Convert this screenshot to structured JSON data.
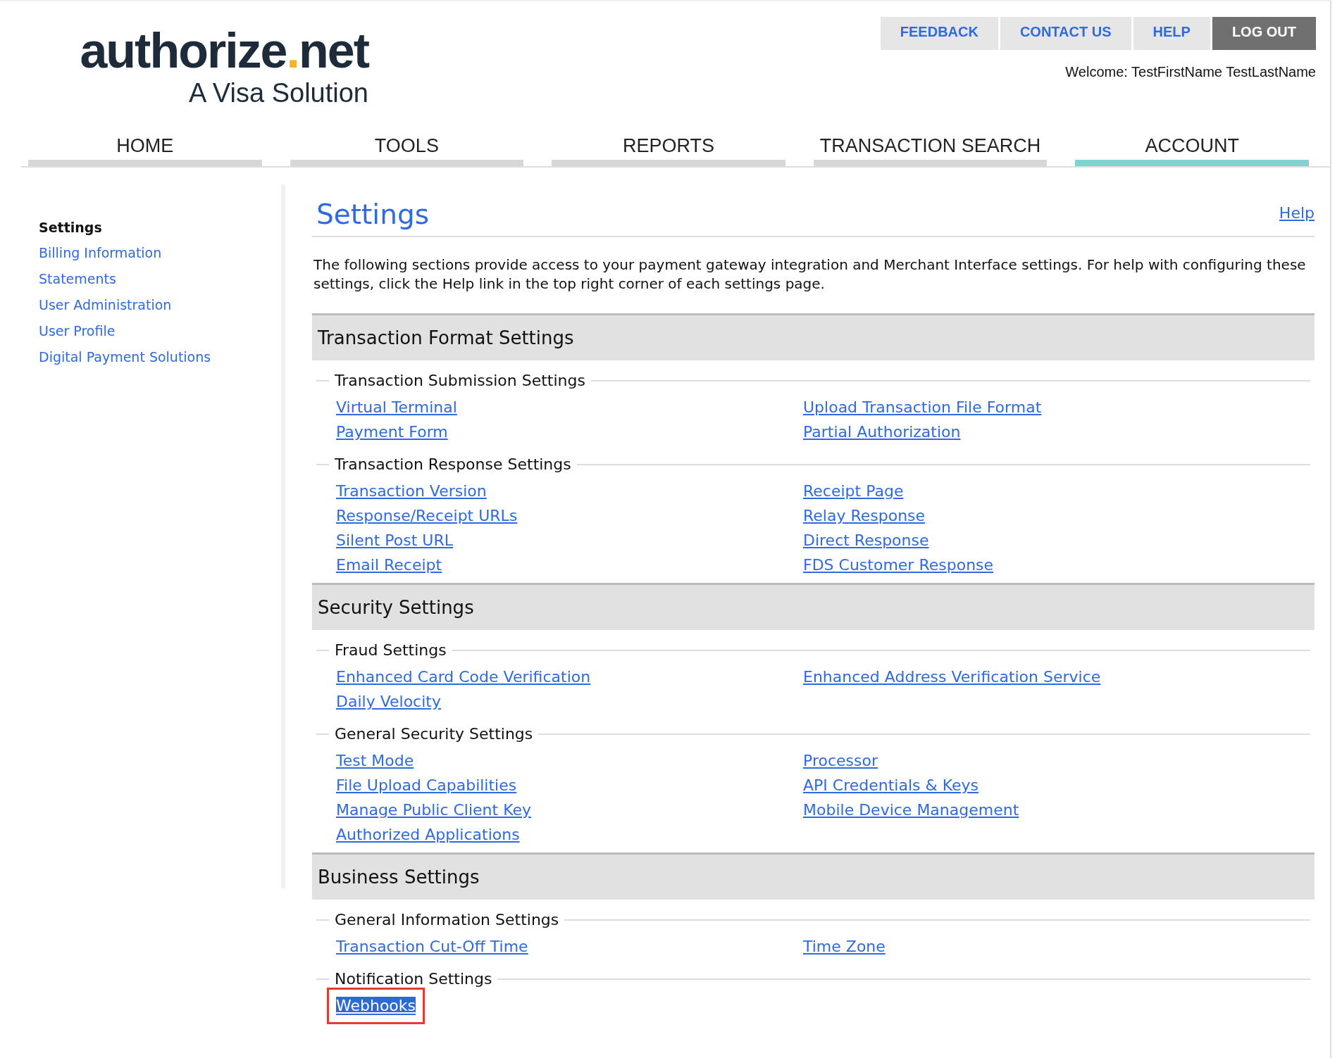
{
  "logo": {
    "wordmark_start": "authorize",
    "wordmark_dot": ".",
    "wordmark_end": "net",
    "tagline": "A Visa Solution"
  },
  "utility_tabs": [
    {
      "label": "FEEDBACK",
      "kind": "light"
    },
    {
      "label": "CONTACT US",
      "kind": "light"
    },
    {
      "label": "HELP",
      "kind": "light"
    },
    {
      "label": "LOG OUT",
      "kind": "dark"
    }
  ],
  "welcome": "Welcome: TestFirstName TestLastName",
  "nav": [
    {
      "label": "HOME",
      "selected": false
    },
    {
      "label": "TOOLS",
      "selected": false
    },
    {
      "label": "REPORTS",
      "selected": false
    },
    {
      "label": "TRANSACTION SEARCH",
      "selected": false
    },
    {
      "label": "ACCOUNT",
      "selected": true
    }
  ],
  "sidebar": {
    "heading": "Settings",
    "items": [
      "Billing Information",
      "Statements",
      "User Administration",
      "User Profile",
      "Digital Payment Solutions"
    ]
  },
  "page": {
    "title": "Settings",
    "help_link": "Help",
    "intro": "The following sections provide access to your payment gateway integration and Merchant Interface settings. For help with configuring these settings, click the Help link in the top right corner of each settings page."
  },
  "sections": [
    {
      "title": "Transaction Format Settings",
      "groups": [
        {
          "title": "Transaction Submission Settings",
          "column_1": [
            {
              "label": "Virtual Terminal",
              "highlighted": false
            },
            {
              "label": "Payment Form",
              "highlighted": false
            }
          ],
          "column_2": [
            {
              "label": "Upload Transaction File Format",
              "highlighted": false
            },
            {
              "label": "Partial Authorization",
              "highlighted": false
            }
          ]
        },
        {
          "title": "Transaction Response Settings",
          "column_1": [
            {
              "label": "Transaction Version",
              "highlighted": false
            },
            {
              "label": "Response/Receipt URLs",
              "highlighted": false
            },
            {
              "label": "Silent Post URL",
              "highlighted": false
            },
            {
              "label": "Email Receipt",
              "highlighted": false
            }
          ],
          "column_2": [
            {
              "label": "Receipt Page",
              "highlighted": false
            },
            {
              "label": "Relay Response",
              "highlighted": false
            },
            {
              "label": "Direct Response",
              "highlighted": false
            },
            {
              "label": "FDS Customer Response",
              "highlighted": false
            }
          ]
        }
      ]
    },
    {
      "title": "Security Settings",
      "groups": [
        {
          "title": "Fraud Settings",
          "column_1": [
            {
              "label": "Enhanced Card Code Verification",
              "highlighted": false
            },
            {
              "label": "Daily Velocity",
              "highlighted": false
            }
          ],
          "column_2": [
            {
              "label": "Enhanced Address Verification Service",
              "highlighted": false
            }
          ]
        },
        {
          "title": "General Security Settings",
          "column_1": [
            {
              "label": "Test Mode",
              "highlighted": false
            },
            {
              "label": "File Upload Capabilities",
              "highlighted": false
            },
            {
              "label": "Manage Public Client Key",
              "highlighted": false
            },
            {
              "label": "Authorized Applications",
              "highlighted": false
            }
          ],
          "column_2": [
            {
              "label": "Processor",
              "highlighted": false
            },
            {
              "label": "API Credentials & Keys",
              "highlighted": false
            },
            {
              "label": "Mobile Device Management",
              "highlighted": false
            }
          ]
        }
      ]
    },
    {
      "title": "Business Settings",
      "groups": [
        {
          "title": "General Information Settings",
          "column_1": [
            {
              "label": "Transaction Cut-Off Time",
              "highlighted": false
            }
          ],
          "column_2": [
            {
              "label": "Time Zone",
              "highlighted": false
            }
          ]
        },
        {
          "title": "Notification Settings",
          "column_1": [
            {
              "label": "Webhooks",
              "highlighted": true
            }
          ]
        }
      ]
    }
  ]
}
